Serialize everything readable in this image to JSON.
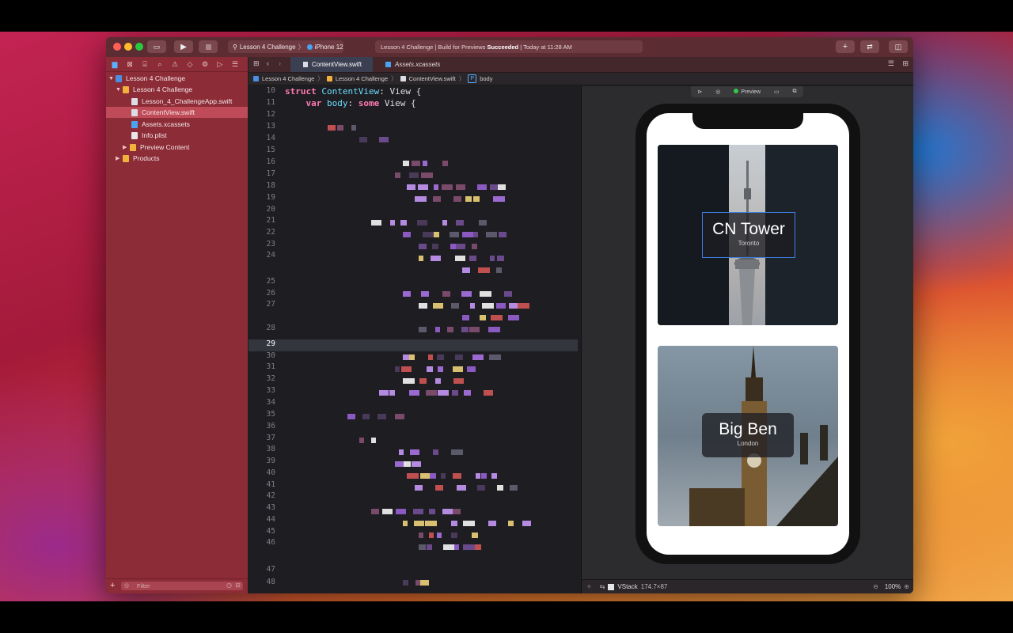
{
  "toolbar": {
    "scheme": "Lesson 4 Challenge",
    "destination": "iPhone 12",
    "activity_prefix": "Lesson 4 Challenge | Build for Previews",
    "activity_status": "Succeeded",
    "activity_time": "| Today at 11:28 AM"
  },
  "navigator": {
    "items": [
      {
        "label": "Lesson 4 Challenge"
      },
      {
        "label": "Lesson 4 Challenge"
      },
      {
        "label": "Lesson_4_ChallengeApp.swift"
      },
      {
        "label": "ContentView.swift"
      },
      {
        "label": "Assets.xcassets"
      },
      {
        "label": "Info.plist"
      },
      {
        "label": "Preview Content"
      },
      {
        "label": "Products"
      }
    ],
    "filter_placeholder": "Filter"
  },
  "tabs": [
    {
      "label": "ContentView.swift"
    },
    {
      "label": "Assets.xcassets"
    }
  ],
  "jumpbar": {
    "items": [
      "Lesson 4 Challenge",
      "Lesson 4 Challenge",
      "ContentView.swift",
      "body"
    ]
  },
  "editor": {
    "line_numbers": [
      "10",
      "11",
      "12",
      "13",
      "14",
      "15",
      "16",
      "17",
      "18",
      "19",
      "20",
      "21",
      "22",
      "23",
      "24",
      "25",
      "26",
      "27",
      "28",
      "29",
      "30",
      "31",
      "32",
      "33",
      "34",
      "35",
      "36",
      "37",
      "38",
      "39",
      "40",
      "41",
      "42",
      "43",
      "44",
      "45",
      "46",
      "47",
      "48"
    ],
    "current_line": "29",
    "code_line_10": {
      "kw": "struct",
      "name": "ContentView",
      "rest": ":",
      "type": "View",
      "end": "{"
    },
    "code_line_11": {
      "kw": "var",
      "name": "body",
      "rest": ":",
      "kw2": "some",
      "type": "View",
      "end": "{"
    }
  },
  "preview": {
    "label": "Preview",
    "cards": [
      {
        "title": "CN Tower",
        "subtitle": "Toronto"
      },
      {
        "title": "Big Ben",
        "subtitle": "London"
      }
    ]
  },
  "canvas_footer": {
    "selection": "VStack",
    "size": "174.7×87",
    "zoom": "100%"
  }
}
